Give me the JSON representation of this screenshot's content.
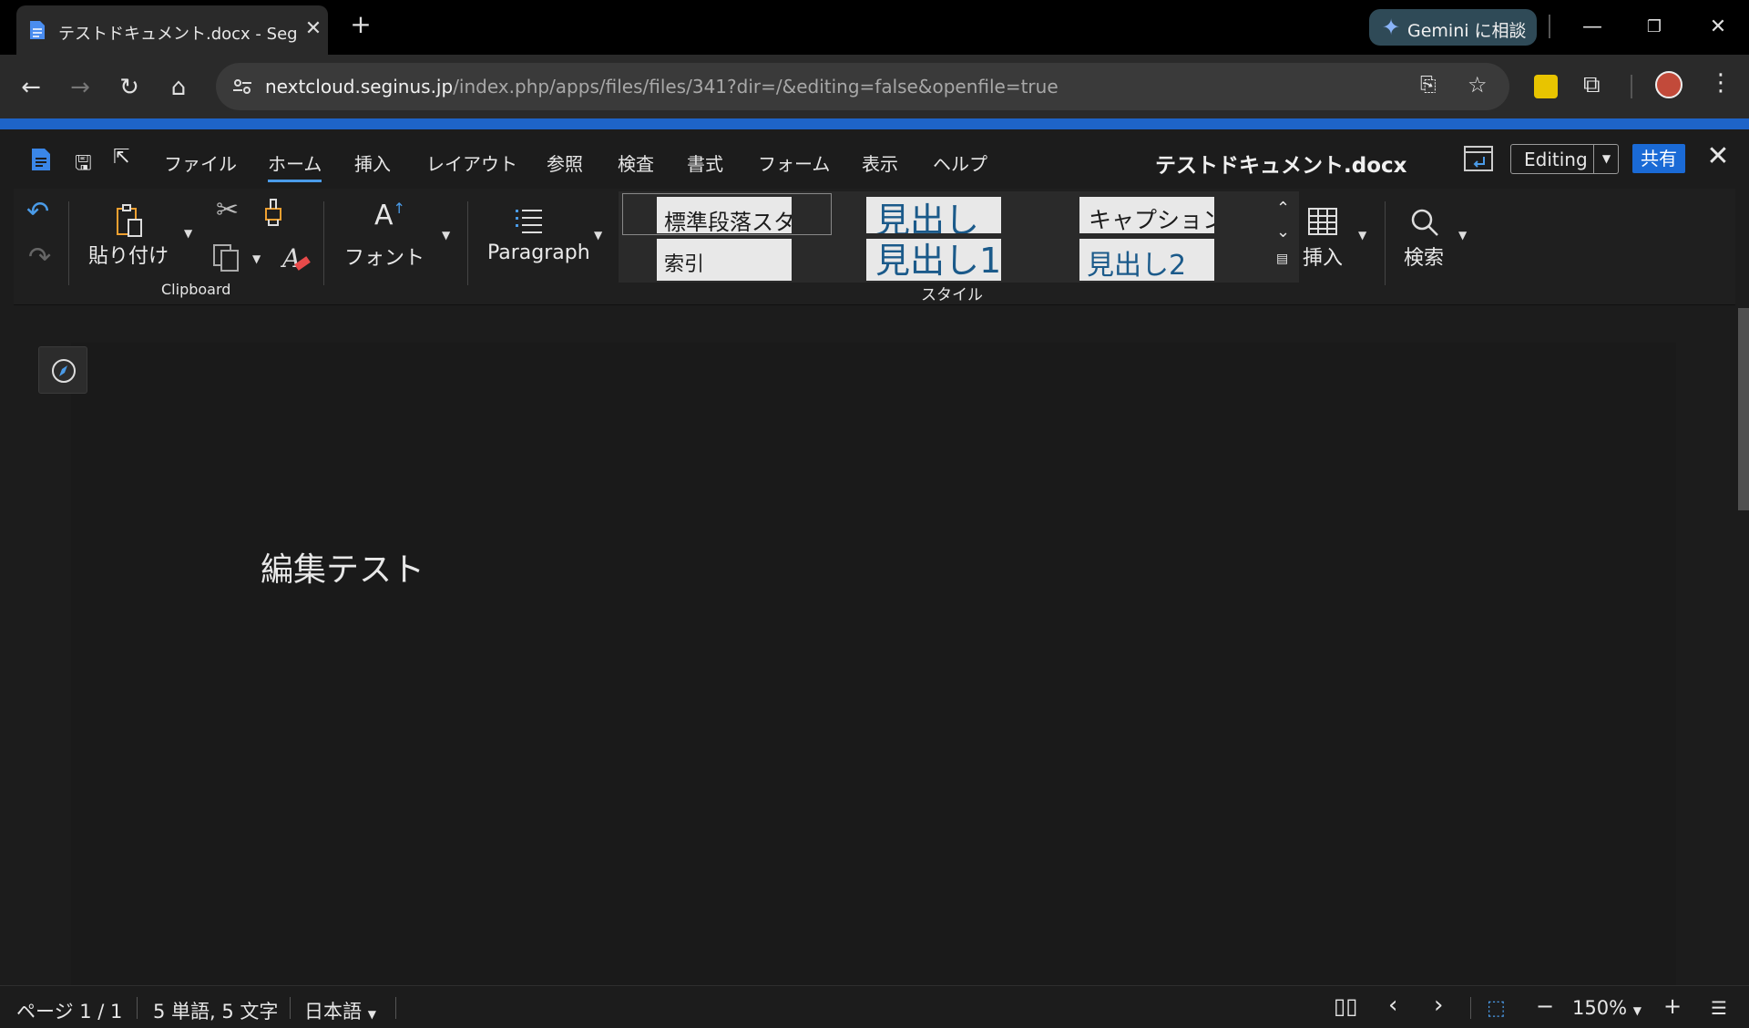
{
  "browser": {
    "tab_title": "テストドキュメント.docx - Seginus C",
    "gemini_label": "Gemini に相談",
    "url_host": "nextcloud.seginus.jp",
    "url_path": "/index.php/apps/files/files/341?dir=/&editing=false&openfile=true"
  },
  "menus": [
    "ファイル",
    "ホーム",
    "挿入",
    "レイアウト",
    "参照",
    "検査",
    "書式",
    "フォーム",
    "表示",
    "ヘルプ"
  ],
  "document_title": "テストドキュメント.docx",
  "mode_label": "Editing",
  "share_label": "共有",
  "ribbon": {
    "paste_label": "貼り付け",
    "clipboard_label": "Clipboard",
    "font_label": "フォント",
    "paragraph_label": "Paragraph",
    "styles_label": "スタイル",
    "styles": {
      "normal": "標準段落スタ",
      "index": "索引",
      "heading": "見出し",
      "heading1": "見出し1",
      "caption": "キャプション",
      "heading2": "見出し2"
    },
    "insert_label": "挿入",
    "search_label": "検索"
  },
  "document_body": "編集テスト",
  "status": {
    "page": "ページ 1 / 1",
    "words": "5 単語, 5 文字",
    "language": "日本語",
    "zoom": "150%"
  },
  "colors": {
    "accent": "#1e64c8",
    "share": "#1a6ad6",
    "active_tab_underline": "#4a9be8"
  }
}
